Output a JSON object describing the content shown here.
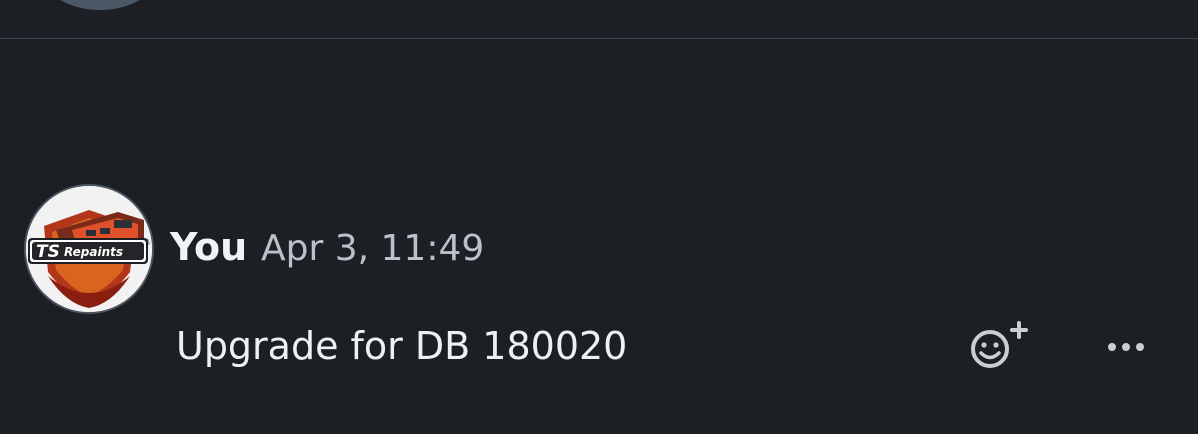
{
  "message": {
    "author": "You",
    "timestamp": "Apr 3, 11:49",
    "text": "Upgrade for DB 180020",
    "avatar_logo": "TSRepaints"
  },
  "actions": {
    "react_icon": "add-reaction-icon",
    "more_icon": "more-options-icon"
  },
  "colors": {
    "background": "#1c2024",
    "divider": "#3b4a56",
    "text_primary": "#eef1f4",
    "text_secondary": "#b9c2cb",
    "icon": "#c9ced3"
  }
}
